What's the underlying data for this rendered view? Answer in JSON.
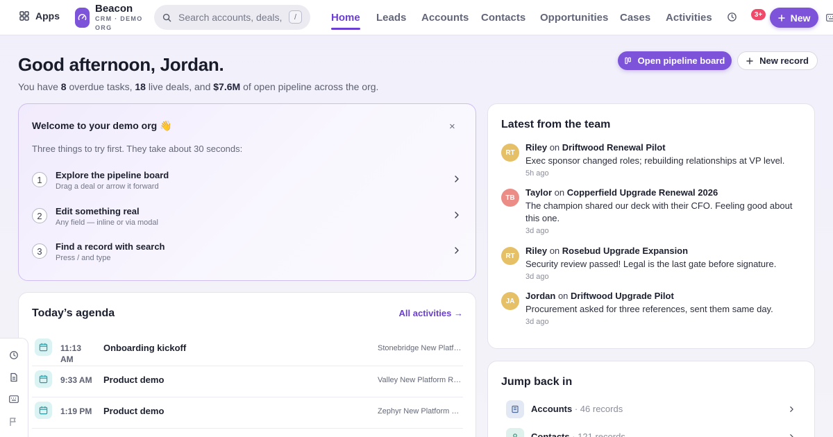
{
  "topbar": {
    "apps_label": "Apps",
    "brand": {
      "name": "Beacon",
      "subtitle": "CRM · DEMO ORG"
    },
    "search": {
      "placeholder": "Search accounts, deals, ...",
      "shortcut": "/"
    },
    "nav": [
      {
        "label": "Home",
        "active": true
      },
      {
        "label": "Leads",
        "active": false
      },
      {
        "label": "Accounts",
        "active": false
      },
      {
        "label": "Contacts",
        "active": false
      },
      {
        "label": "Opportunities",
        "active": false
      },
      {
        "label": "Cases",
        "active": false
      },
      {
        "label": "Activities",
        "active": false
      }
    ],
    "notification_badge": "3+",
    "new_button": "New"
  },
  "hero": {
    "greeting": "Good afternoon, Jordan.",
    "summary": {
      "prefix": "You have ",
      "overdue_tasks": "8",
      "text1": " overdue tasks, ",
      "live_deals": "18",
      "text2": " live deals, and ",
      "pipeline": "$7.6M",
      "text3": " of open pipeline across the org."
    },
    "open_pipeline_button": "Open pipeline board",
    "new_record_button": "New record"
  },
  "welcome": {
    "title": "Welcome to your demo org 👋",
    "close": "×",
    "subtitle": "Three things to try first. They take about 30 seconds:",
    "steps": [
      {
        "num": "1",
        "title": "Explore the pipeline board",
        "desc": "Drag a deal or arrow it forward"
      },
      {
        "num": "2",
        "title": "Edit something real",
        "desc": "Any field — inline or via modal"
      },
      {
        "num": "3",
        "title": "Find a record with search",
        "desc": "Press / and type"
      }
    ]
  },
  "agenda": {
    "title": "Today’s agenda",
    "link": "All activities →",
    "items": [
      {
        "time": "11:13 AM",
        "name": "Onboarding kickoff",
        "deal": "Stonebridge New Platform"
      },
      {
        "time": "9:33 AM",
        "name": "Product demo",
        "deal": "Valley New Platform Rollout"
      },
      {
        "time": "1:19 PM",
        "name": "Product demo",
        "deal": "Zephyr New Platform Pilot"
      }
    ]
  },
  "team": {
    "title": "Latest from the team",
    "posts": [
      {
        "initials": "RT",
        "avatar_color": "#e6c067",
        "author": "Riley",
        "on": " on ",
        "deal": "Driftwood Renewal Pilot",
        "body": "Exec sponsor changed roles; rebuilding relationships at VP level.",
        "time": "5h ago"
      },
      {
        "initials": "TB",
        "avatar_color": "#ec8c86",
        "author": "Taylor",
        "on": " on ",
        "deal": "Copperfield Upgrade Renewal 2026",
        "body": "The champion shared our deck with their CFO. Feeling good about this one.",
        "time": "3d ago"
      },
      {
        "initials": "RT",
        "avatar_color": "#e6c067",
        "author": "Riley",
        "on": " on ",
        "deal": "Rosebud Upgrade Expansion",
        "body": "Security review passed! Legal is the last gate before signature.",
        "time": "3d ago"
      },
      {
        "initials": "JA",
        "avatar_color": "#e6c067",
        "author": "Jordan",
        "on": " on ",
        "deal": "Driftwood Upgrade Pilot",
        "body": "Procurement asked for three references, sent them same day.",
        "time": "3d ago"
      }
    ]
  },
  "jump": {
    "title": "Jump back in",
    "items": [
      {
        "label": "Accounts",
        "count": " · 46 records"
      },
      {
        "label": "Contacts",
        "count": " · 121 records"
      }
    ]
  },
  "colors": {
    "accent": "#7c53d9",
    "nav_active": "#6b3fd4",
    "badge": "#ef4a6a",
    "agenda_icon": "#dcf3f4"
  },
  "icons": {
    "apps": "grid-icon",
    "logo": "gauge-icon",
    "search": "search-icon",
    "history": "clock-icon",
    "rail": [
      "clock-icon",
      "document-icon",
      "keyboard-icon",
      "flag-icon"
    ]
  }
}
